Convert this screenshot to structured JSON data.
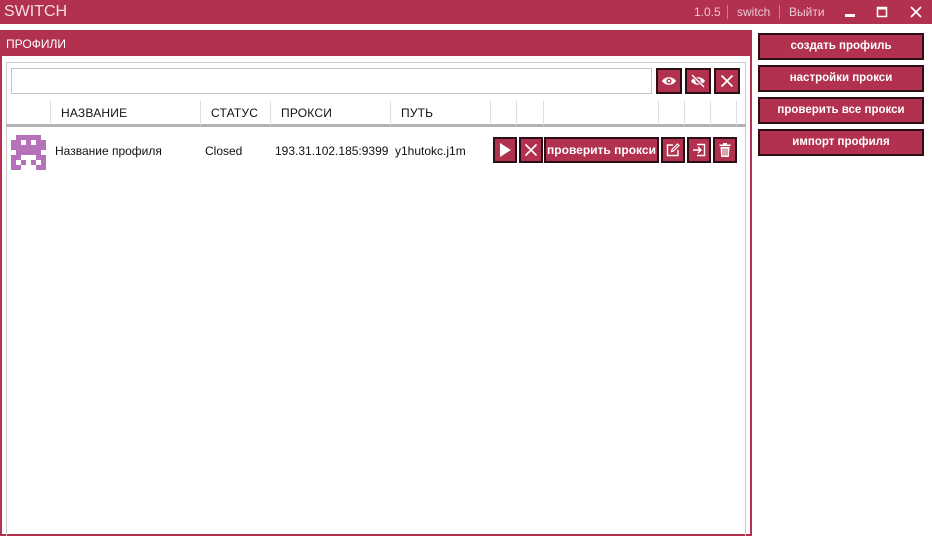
{
  "app": {
    "title": "SWITCH",
    "version": "1.0.5",
    "user": "switch",
    "logout_label": "Выйти"
  },
  "colors": {
    "accent": "#b2314f",
    "button_border": "#2a0f16",
    "avatar": "#b571b9"
  },
  "panel": {
    "title": "ПРОФИЛИ"
  },
  "search": {
    "value": "",
    "placeholder": ""
  },
  "toolbar_icons": [
    "eye-icon",
    "eye-off-icon",
    "close-icon"
  ],
  "table": {
    "columns": [
      "",
      "НАЗВАНИЕ",
      "СТАТУС",
      "ПРОКСИ",
      "ПУТЬ",
      "",
      "",
      "",
      "",
      "",
      ""
    ],
    "rows": [
      {
        "name": "Название профиля",
        "status": "Closed",
        "proxy": "193.31.102.185:9399",
        "path": "y1hutokc.j1m",
        "check_proxy_label": "проверить прокси",
        "action_icons": [
          "play-icon",
          "close-icon",
          "edit-icon",
          "export-icon",
          "trash-icon"
        ]
      }
    ]
  },
  "sidebar": {
    "buttons": [
      {
        "label": "создать профиль"
      },
      {
        "label": "настройки прокси"
      },
      {
        "label": "проверить все прокси"
      },
      {
        "label": "импорт профиля"
      }
    ]
  }
}
